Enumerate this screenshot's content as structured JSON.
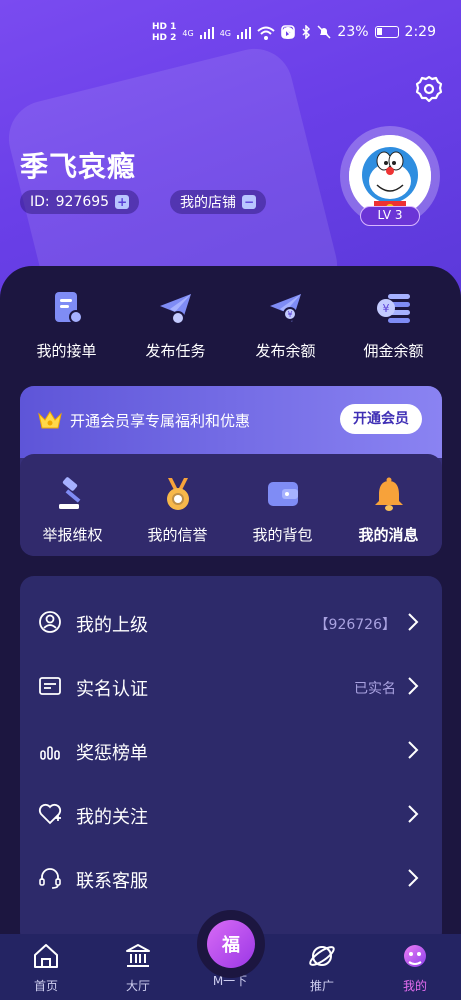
{
  "status_bar": {
    "hd1": "HD 1",
    "hd2": "HD 2",
    "net1": "4G",
    "net2": "4G",
    "battery": "23%",
    "time": "2:29"
  },
  "profile": {
    "name": "季飞哀瘾",
    "id_label": "ID:",
    "id_value": "927695",
    "store_label": "我的店铺",
    "level": "LV 3"
  },
  "quick_actions": [
    {
      "label": "我的接单",
      "icon": "order-doc-icon"
    },
    {
      "label": "发布任务",
      "icon": "paper-plane-icon"
    },
    {
      "label": "发布余额",
      "icon": "paper-plane-yen-icon"
    },
    {
      "label": "佣金余额",
      "icon": "coin-stack-icon"
    }
  ],
  "vip": {
    "text": "开通会员享专属福利和优惠",
    "button": "开通会员",
    "icon": "crown-icon"
  },
  "sub_actions": [
    {
      "label": "举报维权",
      "icon": "gavel-icon"
    },
    {
      "label": "我的信誉",
      "icon": "medal-icon"
    },
    {
      "label": "我的背包",
      "icon": "wallet-icon"
    },
    {
      "label": "我的消息",
      "icon": "bell-icon"
    }
  ],
  "menu": [
    {
      "label": "我的上级",
      "value": "【926726】",
      "icon": "user-circle-icon"
    },
    {
      "label": "实名认证",
      "value": "已实名",
      "icon": "id-card-icon"
    },
    {
      "label": "奖惩榜单",
      "value": "",
      "icon": "bar-chart-icon"
    },
    {
      "label": "我的关注",
      "value": "",
      "icon": "heart-plus-icon"
    },
    {
      "label": "联系客服",
      "value": "",
      "icon": "headset-icon"
    }
  ],
  "nav": [
    {
      "label": "首页",
      "icon": "home-icon"
    },
    {
      "label": "大厅",
      "icon": "bank-icon"
    },
    {
      "label": "M一下",
      "icon": "fortune-bag-icon",
      "badge": "福"
    },
    {
      "label": "推广",
      "icon": "planet-icon"
    },
    {
      "label": "我的",
      "icon": "smile-profile-icon"
    }
  ],
  "colors": {
    "accent": "#6a3fe8",
    "panel": "#1c1640",
    "card": "#2d2a6a",
    "nav": "#242463",
    "active": "#e46cf0"
  }
}
